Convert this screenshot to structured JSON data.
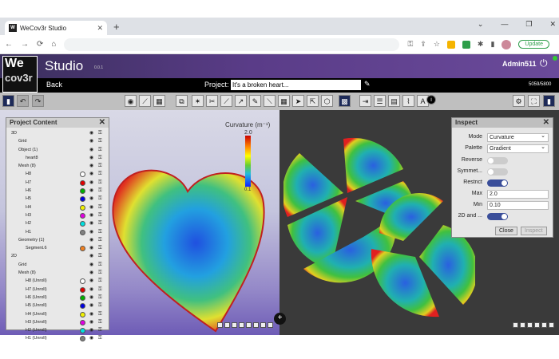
{
  "browser": {
    "tab_title": "WeCov3r Studio",
    "url": "",
    "update_label": "Update"
  },
  "header": {
    "logo_line1": "We",
    "logo_line2": "cov3r",
    "title": "Studio",
    "version": "0.0.1",
    "user": "Admin511"
  },
  "projectbar": {
    "back": "Back",
    "label": "Project:",
    "name": "It's a broken heart...",
    "count": "5059/5800"
  },
  "project_panel": {
    "title": "Project Content",
    "rows": [
      {
        "label": "3D",
        "indent": 0,
        "icon": "▾",
        "swatch": ""
      },
      {
        "label": "Grid",
        "indent": 1,
        "icon": "",
        "swatch": ""
      },
      {
        "label": "Object (1)",
        "indent": 1,
        "icon": "▾",
        "swatch": ""
      },
      {
        "label": "heart8",
        "indent": 2,
        "icon": "",
        "swatch": ""
      },
      {
        "label": "Mesh (8)",
        "indent": 1,
        "icon": "▾",
        "swatch": ""
      },
      {
        "label": "H8",
        "indent": 2,
        "icon": "",
        "swatch": "#ffffff"
      },
      {
        "label": "H7",
        "indent": 2,
        "icon": "",
        "swatch": "#e00000"
      },
      {
        "label": "H6",
        "indent": 2,
        "icon": "",
        "swatch": "#00b000"
      },
      {
        "label": "H5",
        "indent": 2,
        "icon": "",
        "swatch": "#0000e0"
      },
      {
        "label": "H4",
        "indent": 2,
        "icon": "",
        "swatch": "#f0f000"
      },
      {
        "label": "H3",
        "indent": 2,
        "icon": "",
        "swatch": "#e000e0"
      },
      {
        "label": "H2",
        "indent": 2,
        "icon": "",
        "swatch": "#00e0e0"
      },
      {
        "label": "H1",
        "indent": 2,
        "icon": "",
        "swatch": "#808080"
      },
      {
        "label": "Geometry (1)",
        "indent": 1,
        "icon": "▾",
        "swatch": ""
      },
      {
        "label": "Segment.6",
        "indent": 2,
        "icon": "",
        "swatch": "#f08020"
      },
      {
        "label": "2D",
        "indent": 0,
        "icon": "▾",
        "swatch": ""
      },
      {
        "label": "Grid",
        "indent": 1,
        "icon": "",
        "swatch": ""
      },
      {
        "label": "Mesh (8)",
        "indent": 1,
        "icon": "▾",
        "swatch": ""
      },
      {
        "label": "H8 (Unroll)",
        "indent": 2,
        "icon": "",
        "swatch": "#ffffff"
      },
      {
        "label": "H7 (Unroll)",
        "indent": 2,
        "icon": "",
        "swatch": "#e00000"
      },
      {
        "label": "H6 (Unroll)",
        "indent": 2,
        "icon": "",
        "swatch": "#00b000"
      },
      {
        "label": "H5 (Unroll)",
        "indent": 2,
        "icon": "",
        "swatch": "#0000e0"
      },
      {
        "label": "H4 (Unroll)",
        "indent": 2,
        "icon": "",
        "swatch": "#f0f000"
      },
      {
        "label": "H3 (Unroll)",
        "indent": 2,
        "icon": "",
        "swatch": "#e000e0"
      },
      {
        "label": "H2 (Unroll)",
        "indent": 2,
        "icon": "",
        "swatch": "#00e0e0"
      },
      {
        "label": "H1 (Unroll)",
        "indent": 2,
        "icon": "",
        "swatch": "#808080"
      }
    ]
  },
  "colorbar": {
    "title": "Curvature (m⁻¹)",
    "max": "2.0",
    "min": "0.1"
  },
  "inspect": {
    "title": "Inspect",
    "mode_label": "Mode",
    "mode_value": "Curvature",
    "palette_label": "Palette",
    "palette_value": "Gradient",
    "reverse_label": "Reverse",
    "reverse_on": false,
    "symmetric_label": "Symmet...",
    "symmetric_on": false,
    "restrict_label": "Restrict",
    "restrict_on": true,
    "max_label": "Max",
    "max_value": "2.0",
    "min_label": "Min",
    "min_value": "0.10",
    "twod_label": "2D and ...",
    "twod_on": true,
    "close_label": "Close",
    "inspect_label": "Inspect"
  }
}
